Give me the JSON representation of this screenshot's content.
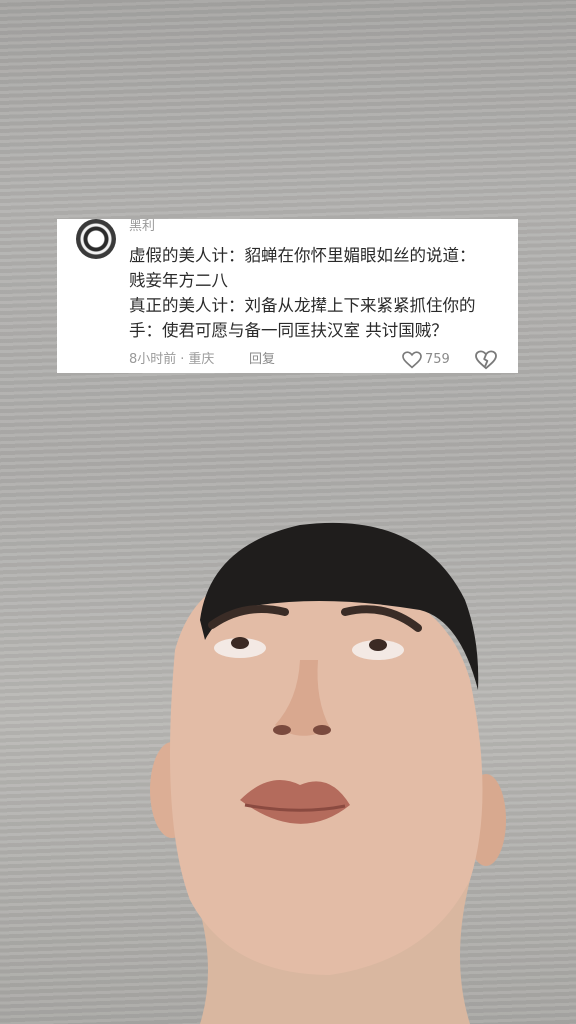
{
  "comment": {
    "username": "黑利",
    "lines": [
      "虚假的美人计：貂蝉在你怀里媚眼如丝的说道：",
      "贱妾年方二八",
      "真正的美人计：刘备从龙撵上下来紧紧抓住你的",
      "手：使君可愿与备一同匡扶汉室 共讨国贼？"
    ],
    "time": "8小时前",
    "separator": "·",
    "location": "重庆",
    "reply_label": "回复",
    "like_count": "759"
  },
  "icons": {
    "like": "heart-icon",
    "dislike": "broken-heart-icon",
    "avatar": "avatar-image"
  }
}
